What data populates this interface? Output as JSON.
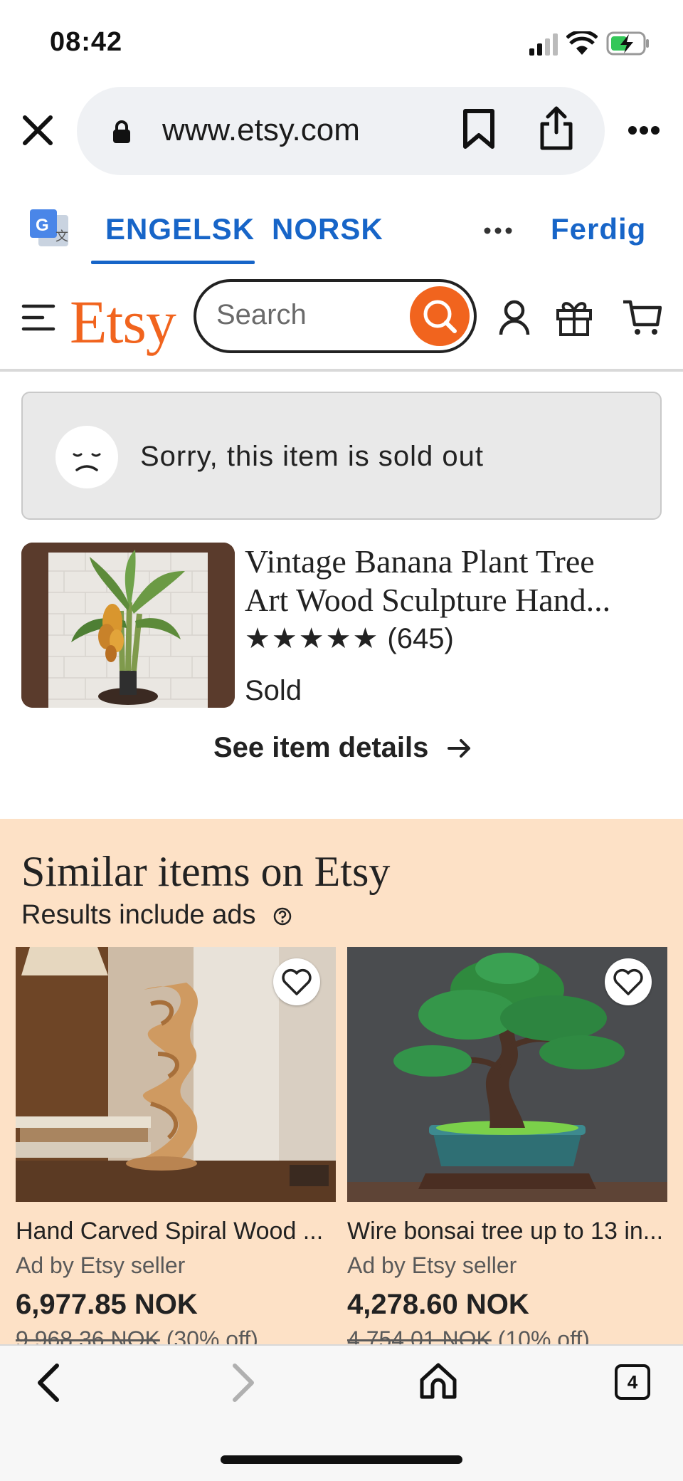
{
  "status_bar": {
    "time": "08:42"
  },
  "browser": {
    "url": "www.etsy.com"
  },
  "translate": {
    "lang_from": "ENGELSK",
    "lang_to": "NORSK",
    "done": "Ferdig"
  },
  "header": {
    "logo": "Etsy",
    "search_placeholder": "Search"
  },
  "notice": {
    "text": "Sorry, this item is sold out"
  },
  "item": {
    "title_line1": "Vintage Banana Plant Tree",
    "title_line2": "Art Wood Sculpture Hand...",
    "stars": "★★★★★",
    "review_count": "(645)",
    "status": "Sold",
    "details_link": "See item details"
  },
  "similar": {
    "title": "Similar items on Etsy",
    "subtitle": "Results include ads",
    "items": [
      {
        "title": "Hand Carved Spiral Wood ...",
        "seller": "Ad by Etsy seller",
        "price": "6,977.85 NOK",
        "original_price": "9,968.36 NOK",
        "discount": "(30% off)"
      },
      {
        "title": "Wire bonsai tree up to 13 in...",
        "seller": "Ad by Etsy seller",
        "price": "4,278.60 NOK",
        "original_price": "4,754.01 NOK",
        "discount": "(10% off)"
      }
    ]
  },
  "bottom_bar": {
    "tab_count": "4"
  },
  "colors": {
    "brand": "#f1641e",
    "link": "#1765c8",
    "similar_bg": "#fde1c6"
  }
}
